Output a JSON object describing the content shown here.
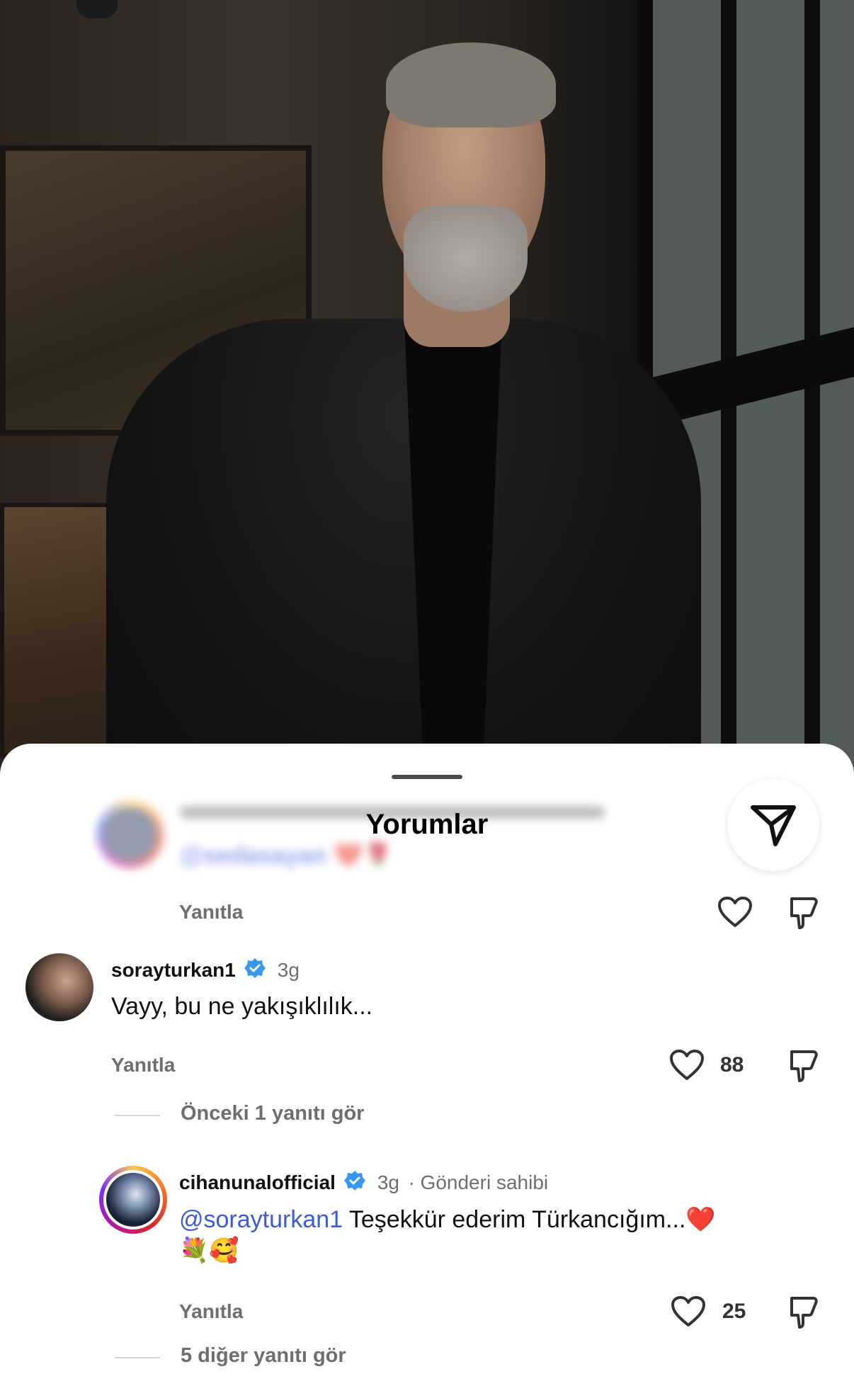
{
  "sheet": {
    "title": "Yorumlar"
  },
  "faded_comment": {
    "mention": "@sedasayan ❤️🌹",
    "reply_label": "Yanıtla"
  },
  "comments": [
    {
      "username": "sorayturkan1",
      "verified": true,
      "time": "3g",
      "text": "Vayy, bu ne yakışıklılık...",
      "reply_label": "Yanıtla",
      "likes": "88",
      "view_replies": "Önceki 1 yanıtı gör"
    },
    {
      "username": "cihanunalofficial",
      "verified": true,
      "time": "3g",
      "owner_tag": "· Gönderi sahibi",
      "mention": "@sorayturkan1",
      "text": " Teşekkür ederim Türkancığım...❤️",
      "text_line2": "💐🥰",
      "reply_label": "Yanıtla",
      "likes": "25",
      "view_replies": "5 diğer yanıtı gör"
    }
  ],
  "icons": {
    "share": "paper-plane-icon",
    "like": "heart-icon",
    "dislike": "thumbs-down-icon",
    "verified": "verified-badge-icon"
  },
  "colors": {
    "accent_blue": "#3b5bdb",
    "verified_blue": "#3897f0",
    "muted_text": "#6e6e6e"
  }
}
